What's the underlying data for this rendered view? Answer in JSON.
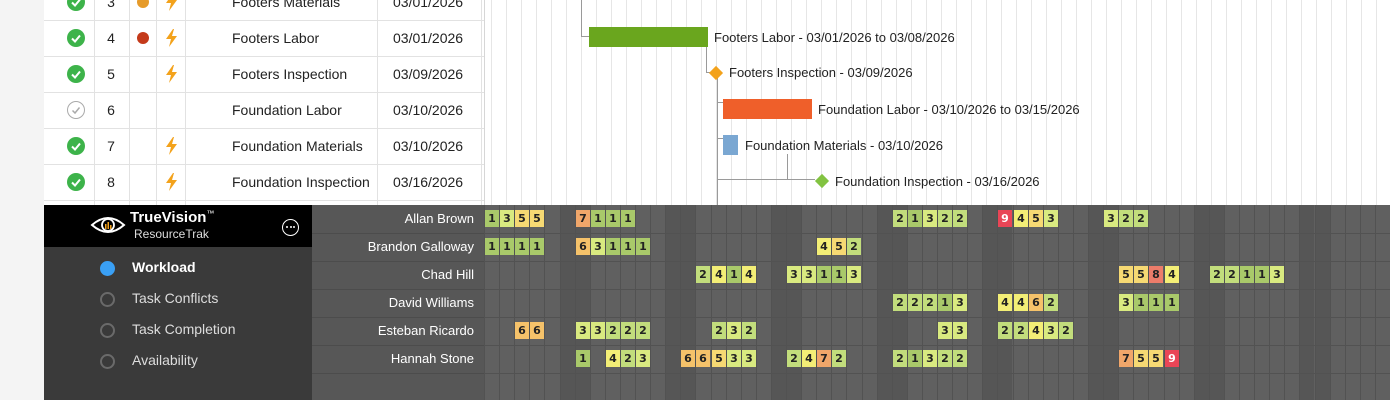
{
  "tasks": [
    {
      "done": true,
      "num": "3",
      "priority": "#e69b2a",
      "bolt": true,
      "name": "Footers Materials",
      "date": "03/01/2026"
    },
    {
      "done": true,
      "num": "4",
      "priority": "#c43a1a",
      "bolt": true,
      "name": "Footers Labor",
      "date": "03/01/2026"
    },
    {
      "done": true,
      "num": "5",
      "priority": "",
      "bolt": true,
      "name": "Footers Inspection",
      "date": "03/09/2026"
    },
    {
      "done": false,
      "num": "6",
      "priority": "",
      "bolt": false,
      "name": "Foundation Labor",
      "date": "03/10/2026"
    },
    {
      "done": true,
      "num": "7",
      "priority": "",
      "bolt": true,
      "name": "Foundation Materials",
      "date": "03/10/2026"
    },
    {
      "done": true,
      "num": "8",
      "priority": "",
      "bolt": true,
      "name": "Foundation Inspection",
      "date": "03/16/2026"
    }
  ],
  "gantt": {
    "items": [
      {
        "kind": "bar",
        "label": "Footers Labor - 03/01/2026 to 03/08/2026",
        "color": "#6aa61e"
      },
      {
        "kind": "milestone",
        "label": "Footers Inspection - 03/09/2026",
        "color": "#f3a21b"
      },
      {
        "kind": "bar",
        "label": "Foundation Labor - 03/10/2026 to 03/15/2026",
        "color": "#ef5f2a"
      },
      {
        "kind": "bar",
        "label": "Foundation Materials - 03/10/2026",
        "color": "#7aa7d2"
      },
      {
        "kind": "milestone",
        "label": "Foundation Inspection - 03/16/2026",
        "color": "#82c341"
      }
    ]
  },
  "brand": {
    "name": "TrueVision",
    "tm": "™",
    "sub": "ResourceTrak",
    "logo_icon": "eye-icon",
    "menu_icon": "more-icon"
  },
  "nav": [
    {
      "label": "Workload",
      "selected": true
    },
    {
      "label": "Task Conflicts",
      "selected": false
    },
    {
      "label": "Task Completion",
      "selected": false
    },
    {
      "label": "Availability",
      "selected": false
    }
  ],
  "workload": {
    "people": [
      "Allan Brown",
      "Brandon Galloway",
      "Chad Hill",
      "David Williams",
      "Esteban Ricardo",
      "Hannah Stone"
    ],
    "colors": {
      "1": "#a9c96a",
      "2": "#c2dd7c",
      "3": "#d9ea80",
      "4": "#f3ee76",
      "5": "#f6d973",
      "6": "#f5c26a",
      "7": "#f0a66a",
      "8": "#ec7c6a",
      "9": "#e94556"
    },
    "rows": [
      {
        "cells": [
          [
            0,
            "1"
          ],
          [
            1,
            "3"
          ],
          [
            2,
            "5"
          ],
          [
            3,
            "5"
          ],
          [
            6,
            "7"
          ],
          [
            7,
            "1"
          ],
          [
            8,
            "1"
          ],
          [
            9,
            "1"
          ],
          [
            27,
            "2"
          ],
          [
            28,
            "1"
          ],
          [
            29,
            "3"
          ],
          [
            30,
            "2"
          ],
          [
            31,
            "2"
          ],
          [
            34,
            "9"
          ],
          [
            35,
            "4"
          ],
          [
            36,
            "5"
          ],
          [
            37,
            "3"
          ],
          [
            41,
            "3"
          ],
          [
            42,
            "2"
          ],
          [
            43,
            "2"
          ]
        ]
      },
      {
        "cells": [
          [
            0,
            "1"
          ],
          [
            1,
            "1"
          ],
          [
            2,
            "1"
          ],
          [
            3,
            "1"
          ],
          [
            6,
            "6"
          ],
          [
            7,
            "3"
          ],
          [
            8,
            "1"
          ],
          [
            9,
            "1"
          ],
          [
            10,
            "1"
          ],
          [
            22,
            "4"
          ],
          [
            23,
            "5"
          ],
          [
            24,
            "2"
          ]
        ]
      },
      {
        "cells": [
          [
            14,
            "2"
          ],
          [
            15,
            "4"
          ],
          [
            16,
            "1"
          ],
          [
            17,
            "4"
          ],
          [
            20,
            "3"
          ],
          [
            21,
            "3"
          ],
          [
            22,
            "1"
          ],
          [
            23,
            "1"
          ],
          [
            24,
            "3"
          ],
          [
            42,
            "5"
          ],
          [
            43,
            "5"
          ],
          [
            44,
            "8"
          ],
          [
            45,
            "4"
          ],
          [
            48,
            "2"
          ],
          [
            49,
            "2"
          ],
          [
            50,
            "1"
          ],
          [
            51,
            "1"
          ],
          [
            52,
            "3"
          ]
        ]
      },
      {
        "cells": [
          [
            27,
            "2"
          ],
          [
            28,
            "2"
          ],
          [
            29,
            "2"
          ],
          [
            30,
            "1"
          ],
          [
            31,
            "3"
          ],
          [
            34,
            "4"
          ],
          [
            35,
            "4"
          ],
          [
            36,
            "6"
          ],
          [
            37,
            "2"
          ],
          [
            42,
            "3"
          ],
          [
            43,
            "1"
          ],
          [
            44,
            "1"
          ],
          [
            45,
            "1"
          ]
        ]
      },
      {
        "cells": [
          [
            2,
            "6"
          ],
          [
            3,
            "6"
          ],
          [
            6,
            "3"
          ],
          [
            7,
            "3"
          ],
          [
            8,
            "2"
          ],
          [
            9,
            "2"
          ],
          [
            10,
            "2"
          ],
          [
            15,
            "2"
          ],
          [
            16,
            "3"
          ],
          [
            17,
            "2"
          ],
          [
            30,
            "3"
          ],
          [
            31,
            "3"
          ],
          [
            34,
            "2"
          ],
          [
            35,
            "2"
          ],
          [
            36,
            "4"
          ],
          [
            37,
            "3"
          ],
          [
            38,
            "2"
          ]
        ]
      },
      {
        "cells": [
          [
            6,
            "1"
          ],
          [
            8,
            "4"
          ],
          [
            9,
            "2"
          ],
          [
            10,
            "3"
          ],
          [
            13,
            "6"
          ],
          [
            14,
            "6"
          ],
          [
            15,
            "5"
          ],
          [
            16,
            "3"
          ],
          [
            17,
            "3"
          ],
          [
            20,
            "2"
          ],
          [
            21,
            "4"
          ],
          [
            22,
            "7"
          ],
          [
            23,
            "2"
          ],
          [
            27,
            "2"
          ],
          [
            28,
            "1"
          ],
          [
            29,
            "3"
          ],
          [
            30,
            "2"
          ],
          [
            31,
            "2"
          ],
          [
            42,
            "7"
          ],
          [
            43,
            "5"
          ],
          [
            44,
            "5"
          ],
          [
            45,
            "9"
          ]
        ]
      }
    ]
  }
}
